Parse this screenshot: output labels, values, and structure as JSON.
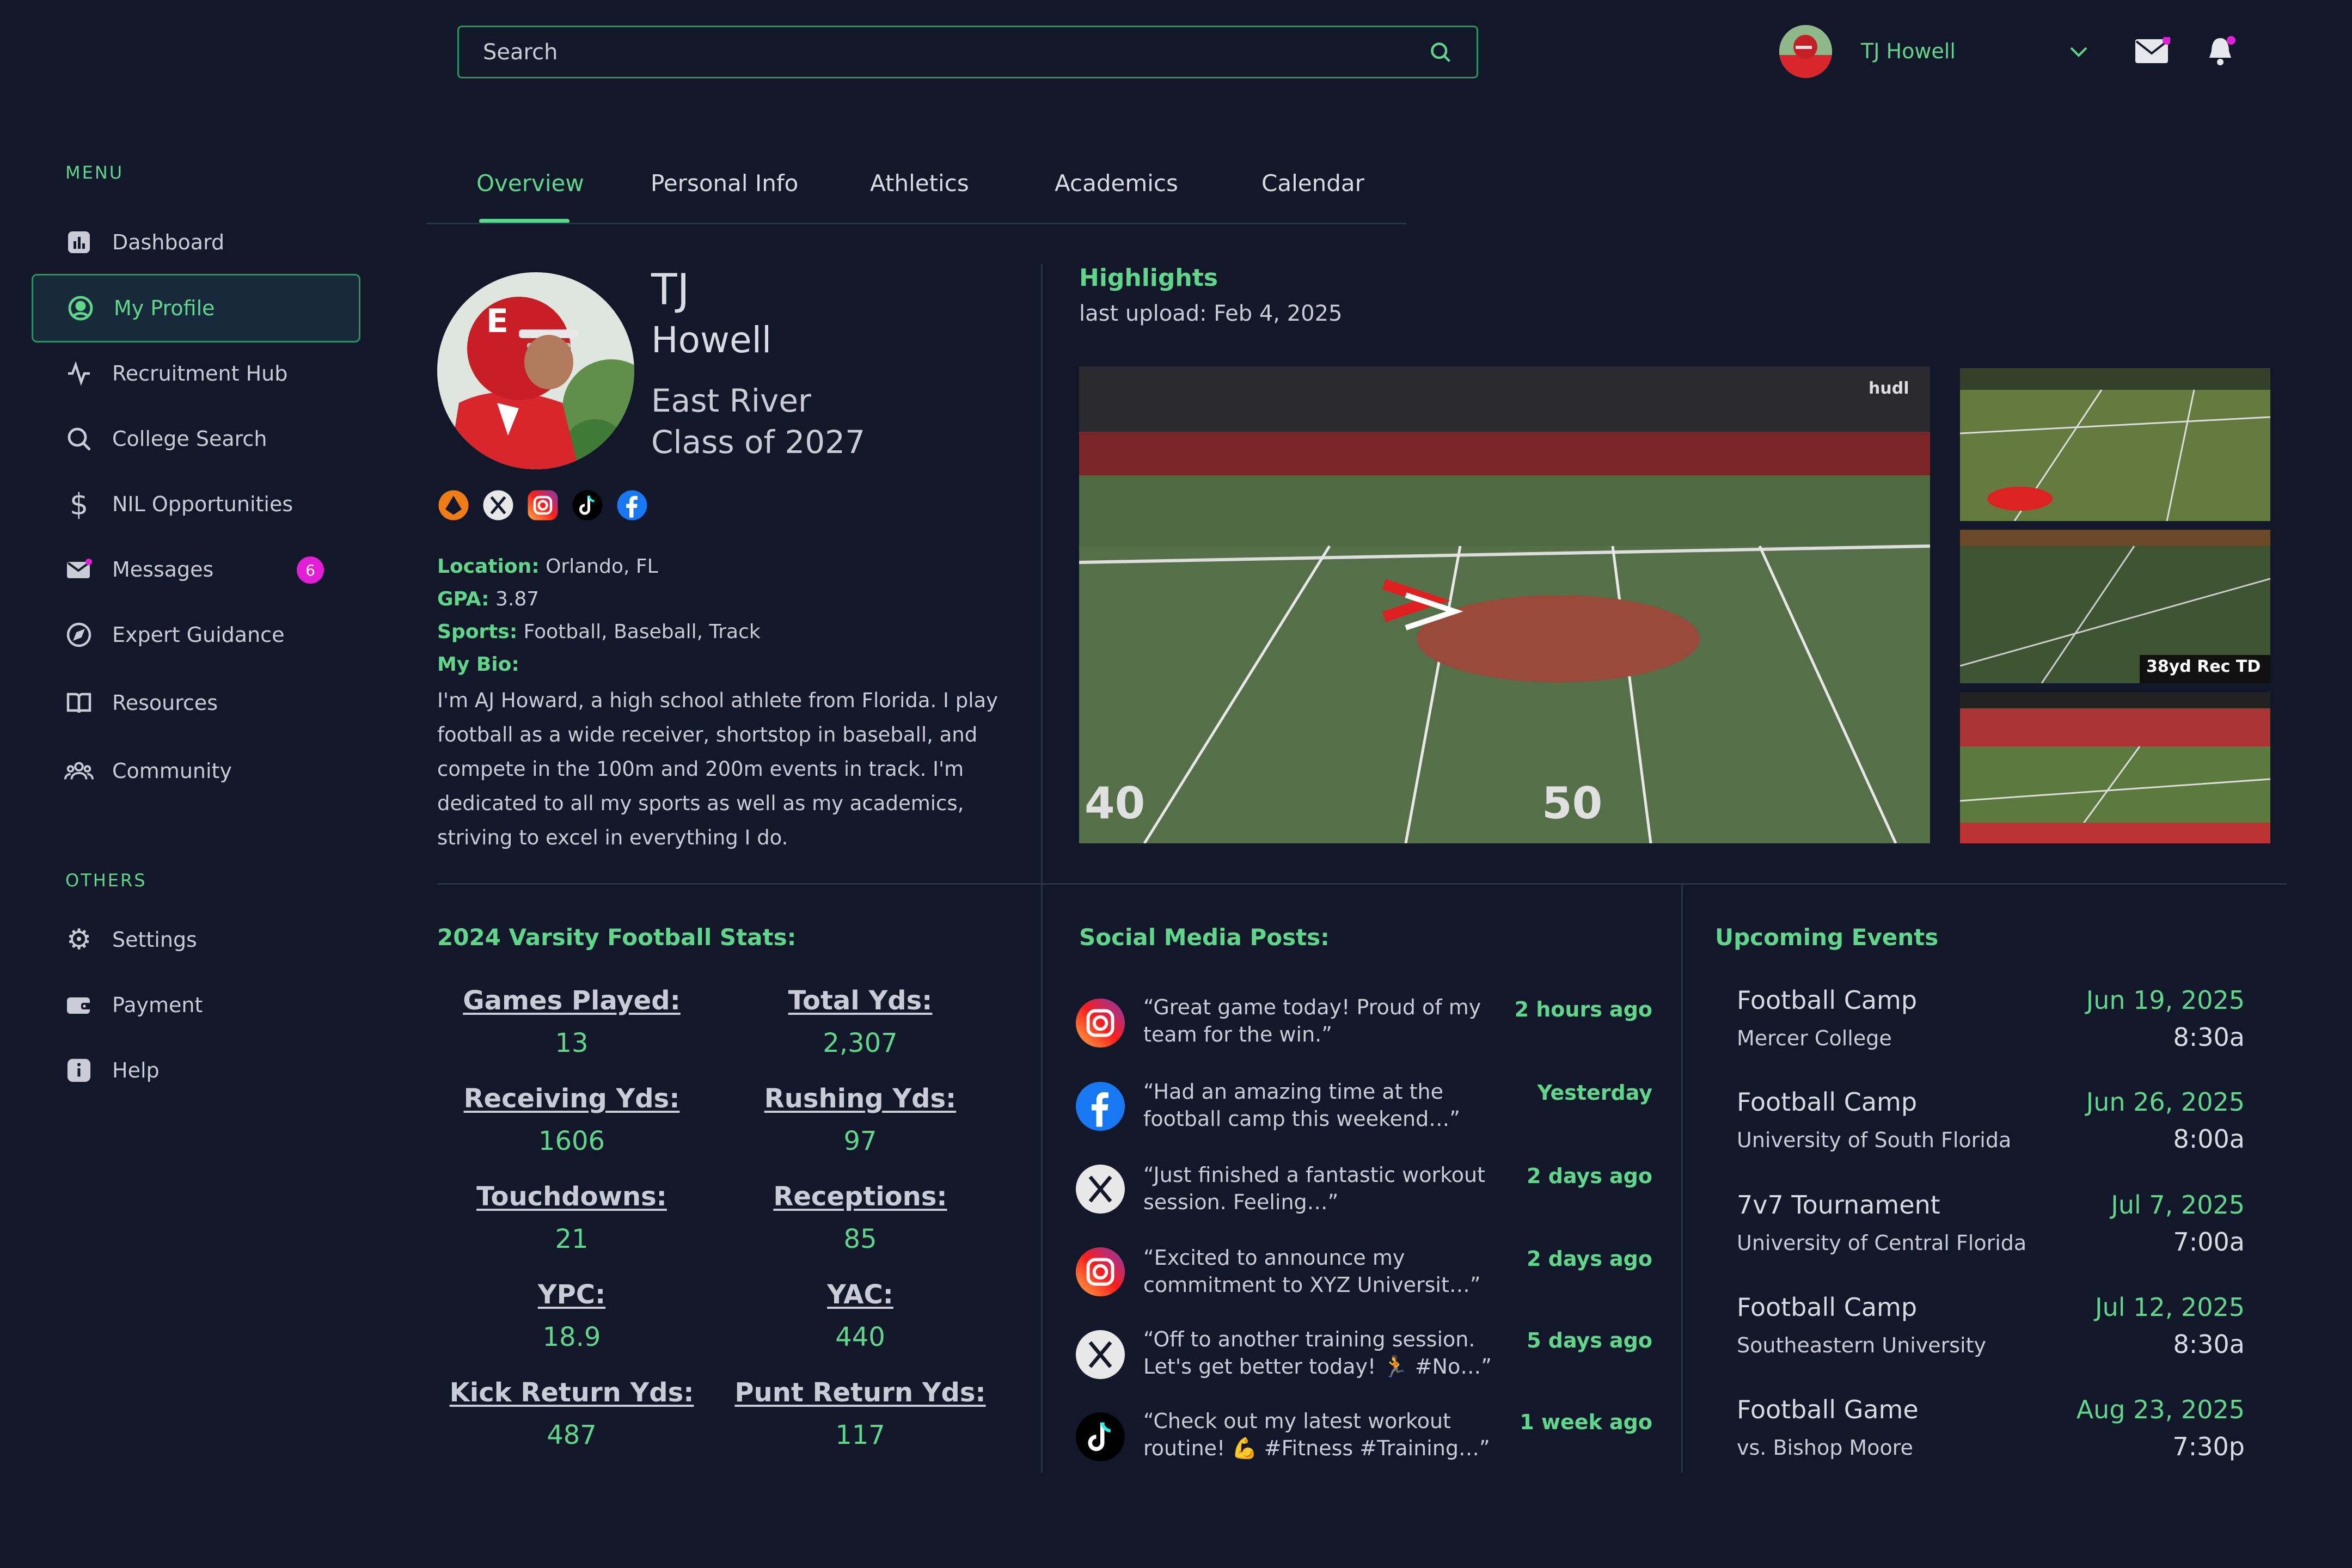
{
  "search": {
    "placeholder": "Search"
  },
  "user": {
    "name": "TJ Howell"
  },
  "sidebar": {
    "menu_heading": "MENU",
    "items": [
      {
        "label": "Dashboard",
        "icon": "bar-chart-icon"
      },
      {
        "label": "My Profile",
        "icon": "user-circle-icon"
      },
      {
        "label": "Recruitment Hub",
        "icon": "activity-icon"
      },
      {
        "label": "College Search",
        "icon": "search-icon"
      },
      {
        "label": "NIL Opportunities",
        "icon": "dollar-icon"
      },
      {
        "label": "Messages",
        "icon": "mail-icon",
        "badge": "6"
      },
      {
        "label": "Expert Guidance",
        "icon": "compass-icon"
      },
      {
        "label": "Resources",
        "icon": "book-icon"
      },
      {
        "label": "Community",
        "icon": "users-icon"
      }
    ],
    "others_heading": "OTHERS",
    "others": [
      {
        "label": "Settings",
        "icon": "gear-icon"
      },
      {
        "label": "Payment",
        "icon": "wallet-icon"
      },
      {
        "label": "Help",
        "icon": "info-icon"
      }
    ]
  },
  "tabs": [
    "Overview",
    "Personal Info",
    "Athletics",
    "Academics",
    "Calendar"
  ],
  "profile": {
    "first_name": "TJ",
    "last_name": "Howell",
    "school": "East River",
    "class": "Class of 2027",
    "location_label": "Location:",
    "location": "Orlando, FL",
    "gpa_label": "GPA:",
    "gpa": "3.87",
    "sports_label": "Sports:",
    "sports": "Football, Baseball, Track",
    "bio_label": "My Bio:",
    "bio": "I'm AJ Howard, a high school athlete from Florida. I play football as a wide receiver, shortstop in baseball, and compete in the 100m and 200m events in track. I'm dedicated to all my sports as well as my academics, striving to excel in everything I do."
  },
  "highlights": {
    "title": "Highlights",
    "last_upload": "last upload: Feb 4, 2025",
    "watermark": "hudl",
    "thumb_caption": "38yd Rec TD"
  },
  "stats": {
    "title": "2024 Varsity Football Stats:",
    "items": [
      {
        "label": "Games Played:",
        "value": "13"
      },
      {
        "label": "Total Yds:",
        "value": "2,307"
      },
      {
        "label": "Receiving Yds:",
        "value": "1606"
      },
      {
        "label": "Rushing Yds:",
        "value": "97"
      },
      {
        "label": "Touchdowns:",
        "value": "21"
      },
      {
        "label": "Receptions:",
        "value": "85"
      },
      {
        "label": "YPC:",
        "value": "18.9"
      },
      {
        "label": "YAC:",
        "value": "440"
      },
      {
        "label": "Kick Return Yds:",
        "value": "487"
      },
      {
        "label": "Punt Return Yds:",
        "value": "117"
      }
    ]
  },
  "posts": {
    "title": "Social Media Posts:",
    "items": [
      {
        "platform": "instagram-icon",
        "text": "“Great game today! Proud of my team for the win.”",
        "time": "2 hours ago"
      },
      {
        "platform": "facebook-icon",
        "text": "“Had an amazing time at the football camp this weekend…”",
        "time": "Yesterday"
      },
      {
        "platform": "x-icon",
        "text": "“Just finished a fantastic workout session. Feeling…”",
        "time": "2 days ago"
      },
      {
        "platform": "instagram-icon",
        "text": "“Excited to announce my commitment to XYZ Universit…”",
        "time": "2 days ago"
      },
      {
        "platform": "x-icon",
        "text": "“Off to another training session. Let's get better today! 🏃 #No…”",
        "time": "5 days ago"
      },
      {
        "platform": "tiktok-icon",
        "text": "“Check out my latest workout routine! 💪 #Fitness #Training…”",
        "time": "1 week ago"
      }
    ]
  },
  "events": {
    "title": "Upcoming Events",
    "items": [
      {
        "name": "Football Camp",
        "place": "Mercer College",
        "date": "Jun 19, 2025",
        "time": "8:30a"
      },
      {
        "name": "Football Camp",
        "place": "University of South Florida",
        "date": "Jun 26, 2025",
        "time": "8:00a"
      },
      {
        "name": "7v7 Tournament",
        "place": "University of Central Florida",
        "date": "Jul 7, 2025",
        "time": "7:00a"
      },
      {
        "name": "Football Camp",
        "place": "Southeastern University",
        "date": "Jul 12, 2025",
        "time": "8:30a"
      },
      {
        "name": "Football Game",
        "place": "vs. Bishop Moore",
        "date": "Aug 23, 2025",
        "time": "7:30p"
      }
    ]
  },
  "colors": {
    "background": "#12172a",
    "accent": "#5fd68a",
    "badge": "#e21fd6"
  }
}
